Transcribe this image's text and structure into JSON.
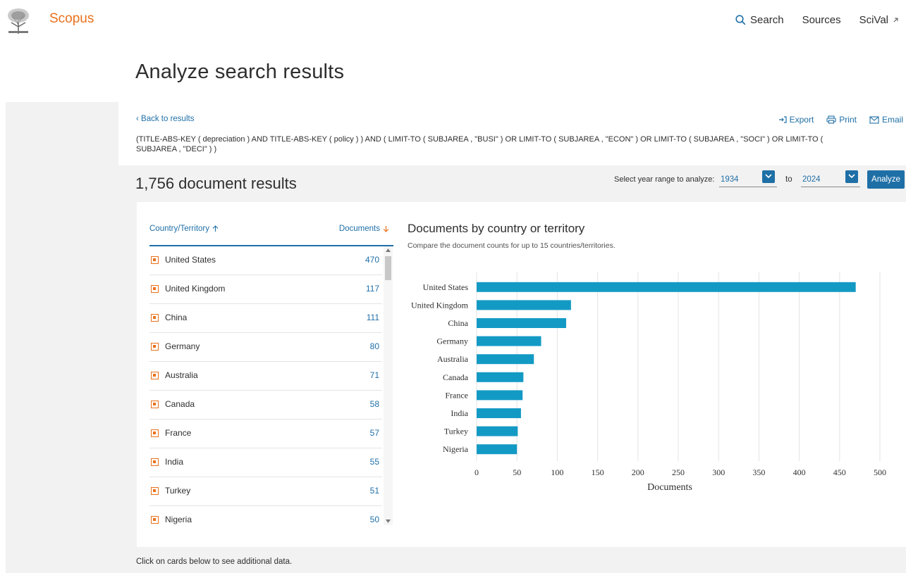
{
  "header": {
    "brand": "Scopus",
    "nav": {
      "search": "Search",
      "sources": "Sources",
      "scival": "SciVal"
    },
    "brand_color": "#e9711c",
    "link_color": "#1f6fa7"
  },
  "page": {
    "title": "Analyze search results",
    "back_link": "Back to results",
    "tools": {
      "export": "Export",
      "print": "Print",
      "email": "Email"
    },
    "query": "(TITLE-ABS-KEY ( depreciation ) AND TITLE-ABS-KEY ( policy ) ) AND ( LIMIT-TO ( SUBJAREA , \"BUSI\" ) OR LIMIT-TO ( SUBJAREA , \"ECON\" ) OR LIMIT-TO ( SUBJAREA , \"SOCI\" ) OR LIMIT-TO ( SUBJAREA , \"DECI\" ) )",
    "result_count": "1,756 document results",
    "year_range": {
      "label": "Select year range to analyze:",
      "from": "1934",
      "to_label": "to",
      "to": "2024",
      "analyze_button": "Analyze"
    },
    "footnote": "Click on cards below to see additional data."
  },
  "table": {
    "col_country": "Country/Territory",
    "col_documents": "Documents",
    "rows": [
      {
        "country": "United States",
        "documents": "470"
      },
      {
        "country": "United Kingdom",
        "documents": "117"
      },
      {
        "country": "China",
        "documents": "111"
      },
      {
        "country": "Germany",
        "documents": "80"
      },
      {
        "country": "Australia",
        "documents": "71"
      },
      {
        "country": "Canada",
        "documents": "58"
      },
      {
        "country": "France",
        "documents": "57"
      },
      {
        "country": "India",
        "documents": "55"
      },
      {
        "country": "Turkey",
        "documents": "51"
      },
      {
        "country": "Nigeria",
        "documents": "50"
      }
    ]
  },
  "chart_data": {
    "type": "bar",
    "orientation": "horizontal",
    "title": "Documents by country or territory",
    "subtitle": "Compare the document counts for up to 15 countries/territories.",
    "categories": [
      "United States",
      "United Kingdom",
      "China",
      "Germany",
      "Australia",
      "Canada",
      "France",
      "India",
      "Turkey",
      "Nigeria"
    ],
    "values": [
      470,
      117,
      111,
      80,
      71,
      58,
      57,
      55,
      51,
      50
    ],
    "xlabel": "Documents",
    "xlim": [
      0,
      500
    ],
    "xticks": [
      "0",
      "50",
      "100",
      "150",
      "200",
      "250",
      "300",
      "350",
      "400",
      "450",
      "500"
    ],
    "grid": "vertical",
    "bar_color": "#139ac4"
  }
}
